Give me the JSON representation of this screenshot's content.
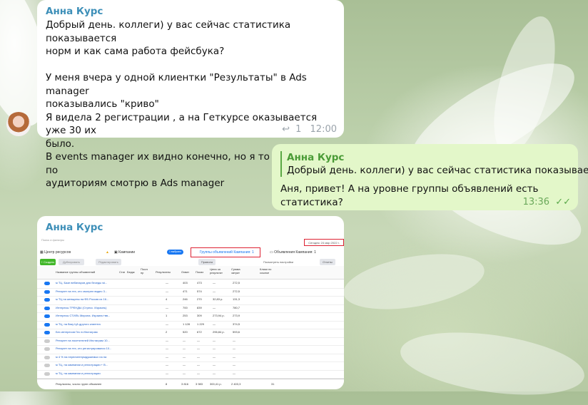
{
  "incoming_message": {
    "sender": "Анна Курс",
    "text": "Добрый день. коллеги)  у вас сейчас статистика показывается\nнорм и как сама работа фейсбука?\n\nУ меня вчера у одной клиентки \"Результаты\"  в Ads manager\nпоказывались \"криво\"\nЯ видела 2 регистрации , а на Геткурсе оказывается уже 30 их\nбыло.\nВ events manager их видно конечно, но я то статистику по\nаудиториям смотрю в Ads manager",
    "reply_count": "1",
    "time": "12:00"
  },
  "outgoing_message": {
    "quote_sender": "Анна Курс",
    "quote_text": "Добрый день. коллеги)  у вас сейчас статистика показывает...",
    "text": "Аня, привет! А на уровне группы объявлений есть статистика?",
    "time": "13:36"
  },
  "image_message": {
    "sender": "Анна Курс",
    "screenshot": {
      "breadcrumb": "Поиск и фильтры",
      "date_range": "Сегодня: 24 мар 2022 г.",
      "resource_center": "Центр ресурсов",
      "tab_campaigns": "Кампании",
      "selected_badge": "1 выбрано",
      "tab_adsets": "Группы объявлений Кампания: 1",
      "tab_ads": "Объявления Кампания: 1",
      "create_btn": "+ Создать",
      "duplicate_btn": "Дублировать",
      "edit_btn": "Редактировать",
      "rules_btn": "Правила",
      "view_settings": "Посмотреть настройки",
      "reports_btn": "Отчеты",
      "columns": [
        "Название группы объявлений",
        "Статус",
        "Бюдж",
        "Последнее пр",
        "Результаты",
        "Охват",
        "Показ",
        "Цена за результат",
        "Сумма затрат",
        "Клики по ссылке"
      ],
      "rows": [
        {
          "name": "м ТЦ. Базе вебинаров для беседы wi...",
          "results": "—",
          "reach": "403",
          "impr": "473",
          "cost": "—",
          "spent": "272,5"
        },
        {
          "name": "Ретаргет на тех, кто смотрел видео 3...",
          "results": "—",
          "reach": "471",
          "impr": "574",
          "cost": "—",
          "spent": "272,5"
        },
        {
          "name": "м ТЦ на женщины на ФБ Россия из 16...",
          "results": "4",
          "reach": "246",
          "impr": "270",
          "cost": "32,83 р.",
          "spent": "131,3"
        },
        {
          "name": "Интересы ТРЕНДЫ (Стресс. Израиль)",
          "results": "—",
          "reach": "700",
          "impr": "839",
          "cost": "—",
          "spent": "780,7"
        },
        {
          "name": "Интересы СТИЛЬ Мирона. Израиль+вв...",
          "results": "1",
          "reach": "253",
          "impr": "309",
          "cost": "273,94 р.",
          "spent": "273,9"
        },
        {
          "name": "м ТЦ, на базу ЦА другого клиента",
          "results": "—",
          "reach": "1 128",
          "impr": "1 229",
          "cost": "—",
          "spent": "374,5"
        },
        {
          "name": "Без интересов Гео в Инстаграм",
          "results": "2",
          "reach": "520",
          "impr": "672",
          "cost": "296,84 р.",
          "spent": "593,6"
        },
        {
          "name": "Ретаргет на посетителей Инстаграм 10...",
          "results": "—",
          "reach": "—",
          "impr": "—",
          "cost": "—",
          "spent": "—"
        },
        {
          "name": "Ретаргет на тех, кто регистрировался 10...",
          "results": "—",
          "reach": "—",
          "impr": "—",
          "cost": "—",
          "spent": "—"
        },
        {
          "name": "м 4 % на перелинтермдукаемых на на",
          "results": "—",
          "reach": "—",
          "impr": "—",
          "cost": "—",
          "spent": "—"
        },
        {
          "name": "м ТЦ, на кампании и регистрации + В...",
          "results": "—",
          "reach": "—",
          "impr": "—",
          "cost": "—",
          "spent": "—"
        },
        {
          "name": "м ТЦ, на кампании и регистрации",
          "results": "—",
          "reach": "—",
          "impr": "—",
          "cost": "—",
          "spent": "—"
        }
      ],
      "footer_label": "Результаты, число групп объявлен",
      "footer_results": "8",
      "footer_reach": "3 816",
      "footer_impr": "3 983",
      "footer_cost": "300,41 р.",
      "footer_spent": "2 403,3",
      "footer_clicks": "31"
    }
  },
  "colors": {
    "accent_name": "#3d8fb8",
    "quote_name": "#4a9b36",
    "outgoing_bg": "#e3f7c9",
    "fb_blue": "#1877f2",
    "highlight_red": "#dd2233"
  }
}
